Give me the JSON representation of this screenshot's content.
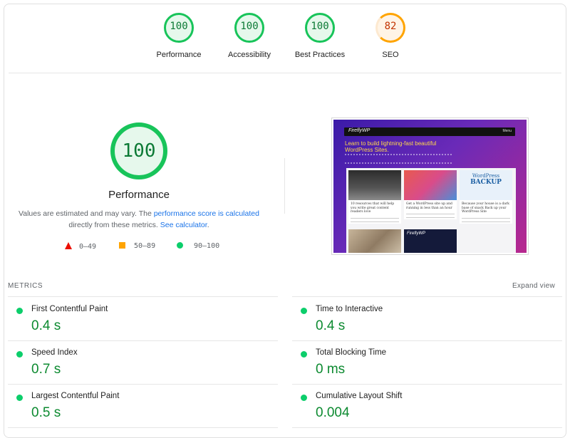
{
  "scores": [
    {
      "name": "performance",
      "score": "100",
      "label": "Performance",
      "status": "pass"
    },
    {
      "name": "accessibility",
      "score": "100",
      "label": "Accessibility",
      "status": "pass"
    },
    {
      "name": "best-practices",
      "score": "100",
      "label": "Best Practices",
      "status": "pass"
    },
    {
      "name": "seo",
      "score": "82",
      "label": "SEO",
      "status": "average",
      "fraction": 0.82
    }
  ],
  "performance": {
    "score": "100",
    "title": "Performance",
    "desc_prefix": "Values are estimated and may vary. The ",
    "desc_link1": "performance score is calculated",
    "desc_middle": " directly from these metrics. ",
    "desc_link2": "See calculator",
    "desc_suffix": "."
  },
  "legend": {
    "fail": "0–49",
    "average": "50–89",
    "pass": "90–100"
  },
  "thumbnail": {
    "brand": "FireflyWP",
    "menu": "Menu",
    "headline": "Learn to build lightning-fast beautiful WordPress Sites.",
    "cards": [
      "10 resources that will help you write great content readers love",
      "Get a WordPress site up and running in less than an hour",
      "Because your house is a dark base of snack Back up your WordPress Site",
      "",
      ""
    ],
    "backup_line1": "WordPress",
    "backup_line2": "BACKUP",
    "ff_logo": "FireflyWP"
  },
  "metrics": {
    "header": "METRICS",
    "expand_label": "Expand view",
    "items": [
      {
        "name": "First Contentful Paint",
        "value": "0.4 s"
      },
      {
        "name": "Time to Interactive",
        "value": "0.4 s"
      },
      {
        "name": "Speed Index",
        "value": "0.7 s"
      },
      {
        "name": "Total Blocking Time",
        "value": "0 ms"
      },
      {
        "name": "Largest Contentful Paint",
        "value": "0.5 s"
      },
      {
        "name": "Cumulative Layout Shift",
        "value": "0.004"
      }
    ]
  },
  "colors": {
    "pass": "#0cce6b",
    "average": "#ffa400",
    "fail": "#eb0f00",
    "link": "#1a73e8"
  }
}
